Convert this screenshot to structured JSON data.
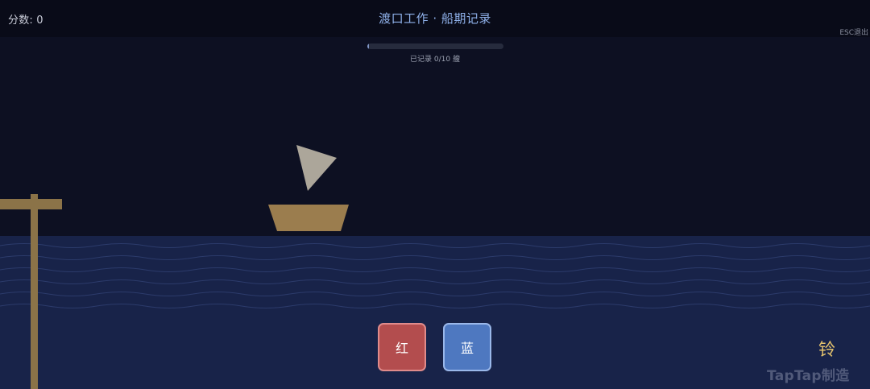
{
  "hud": {
    "score_label": "分数: 0",
    "title": "渡口工作 · 船期记录",
    "exit_hint": "ESC退出"
  },
  "progress": {
    "recorded": 0,
    "total": 10,
    "fraction": 0.0,
    "label": "已记录 0/10 艘"
  },
  "scene": {
    "boat": {
      "hull_color": "#9b7d4e",
      "sail_color": "#aca69a"
    },
    "sea_color": "#182349",
    "sky_color": "#0d1022",
    "pier_color": "#8b7348"
  },
  "controls": {
    "red_label": "红",
    "blue_label": "蓝",
    "bell_label": "铃"
  },
  "watermark": {
    "text": "TapTap制造"
  }
}
